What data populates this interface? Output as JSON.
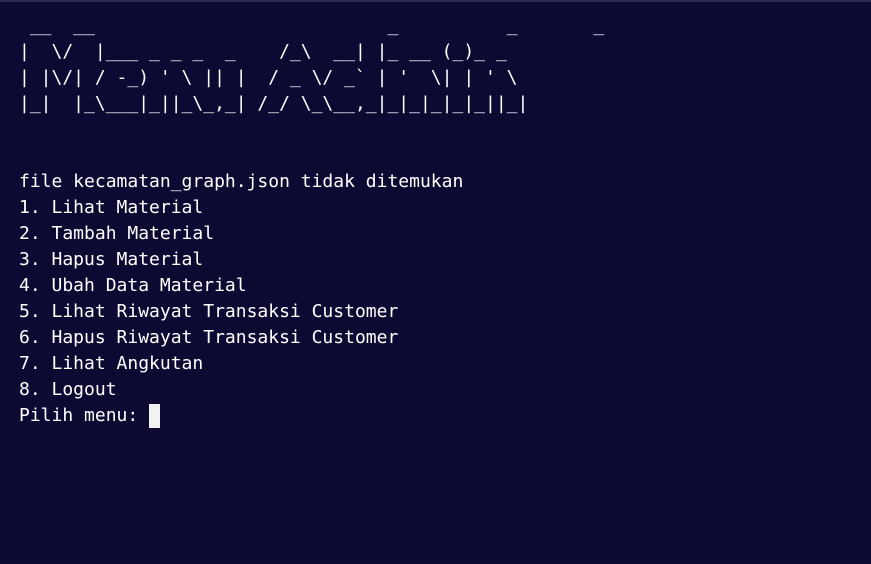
{
  "banner": " __  __                           _          _       _\n|  \\/  |___ _ _ _  _    /_\\  __| |_ __ (_)_ _\n| |\\/| / -_) ' \\ || |  / _ \\/ _` | '  \\| | ' \\\n|_|  |_\\___|_||_\\_,_| /_/ \\_\\__,_|_|_|_|_|_||_|",
  "status_message": "file kecamatan_graph.json tidak ditemukan",
  "menu_items": [
    "1. Lihat Material",
    "2. Tambah Material",
    "3. Hapus Material",
    "4. Ubah Data Material",
    "5. Lihat Riwayat Transaksi Customer",
    "6. Hapus Riwayat Transaksi Customer",
    "7. Lihat Angkutan",
    "8. Logout"
  ],
  "prompt": "Pilih menu:",
  "colors": {
    "background": "#0c0a33",
    "text": "#ffffff",
    "cursor": "#f2f2f2"
  }
}
